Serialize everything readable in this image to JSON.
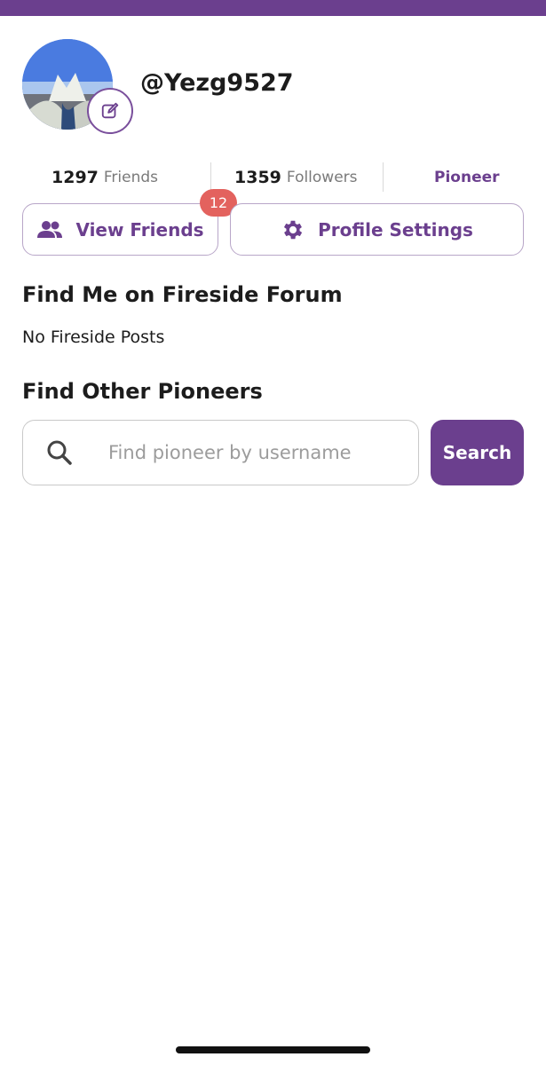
{
  "profile": {
    "username": "@Yezg9527",
    "avatar_alt": "avatar"
  },
  "stats": {
    "friends_count": "1297",
    "friends_label": "Friends",
    "followers_count": "1359",
    "followers_label": "Followers",
    "role": "Pioneer"
  },
  "actions": {
    "view_friends_label": "View Friends",
    "friends_badge": "12",
    "profile_settings_label": "Profile Settings"
  },
  "forum": {
    "title": "Find Me on Fireside Forum",
    "empty_text": "No Fireside Posts"
  },
  "pioneer_search": {
    "title": "Find Other Pioneers",
    "placeholder": "Find pioneer by username",
    "value": "",
    "button_label": "Search"
  },
  "colors": {
    "brand": "#6b3f8e",
    "badge": "#e3625e",
    "border_outline": "#b8a6c8"
  },
  "icons": {
    "edit": "pencil-edit-icon",
    "friends": "people-icon",
    "settings": "gear-icon",
    "search": "search-icon"
  }
}
